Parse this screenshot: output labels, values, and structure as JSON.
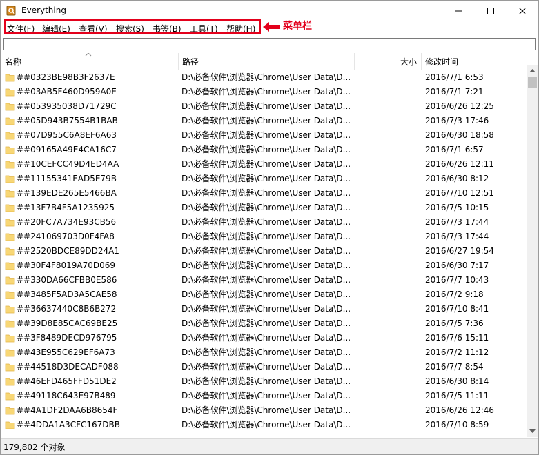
{
  "window": {
    "title": "Everything",
    "minimize_icon": "minimize-icon",
    "maximize_icon": "maximize-icon",
    "close_icon": "close-icon"
  },
  "menu": {
    "items": [
      {
        "label": "文件(F)"
      },
      {
        "label": "编辑(E)"
      },
      {
        "label": "查看(V)"
      },
      {
        "label": "搜索(S)"
      },
      {
        "label": "书签(B)"
      },
      {
        "label": "工具(T)"
      },
      {
        "label": "帮助(H)"
      }
    ]
  },
  "annotation": {
    "label": "菜单栏",
    "color": "#e3001b"
  },
  "search": {
    "value": "",
    "placeholder": ""
  },
  "table": {
    "columns": {
      "name": "名称",
      "path": "路径",
      "size": "大小",
      "modified": "修改时间"
    },
    "rows": [
      {
        "name": "##0323BE98B3F2637E",
        "path": "D:\\必备软件\\浏览器\\Chrome\\User Data\\D...",
        "size": "",
        "modified": "2016/7/1 6:53"
      },
      {
        "name": "##03AB5F460D959A0E",
        "path": "D:\\必备软件\\浏览器\\Chrome\\User Data\\D...",
        "size": "",
        "modified": "2016/7/1 7:21"
      },
      {
        "name": "##053935038D71729C",
        "path": "D:\\必备软件\\浏览器\\Chrome\\User Data\\D...",
        "size": "",
        "modified": "2016/6/26 12:25"
      },
      {
        "name": "##05D943B7554B1BAB",
        "path": "D:\\必备软件\\浏览器\\Chrome\\User Data\\D...",
        "size": "",
        "modified": "2016/7/3 17:46"
      },
      {
        "name": "##07D955C6A8EF6A63",
        "path": "D:\\必备软件\\浏览器\\Chrome\\User Data\\D...",
        "size": "",
        "modified": "2016/6/30 18:58"
      },
      {
        "name": "##09165A49E4CA16C7",
        "path": "D:\\必备软件\\浏览器\\Chrome\\User Data\\D...",
        "size": "",
        "modified": "2016/7/1 6:57"
      },
      {
        "name": "##10CEFCC49D4ED4AA",
        "path": "D:\\必备软件\\浏览器\\Chrome\\User Data\\D...",
        "size": "",
        "modified": "2016/6/26 12:11"
      },
      {
        "name": "##11155341EAD5E79B",
        "path": "D:\\必备软件\\浏览器\\Chrome\\User Data\\D...",
        "size": "",
        "modified": "2016/6/30 8:12"
      },
      {
        "name": "##139EDE265E5466BA",
        "path": "D:\\必备软件\\浏览器\\Chrome\\User Data\\D...",
        "size": "",
        "modified": "2016/7/10 12:51"
      },
      {
        "name": "##13F7B4F5A1235925",
        "path": "D:\\必备软件\\浏览器\\Chrome\\User Data\\D...",
        "size": "",
        "modified": "2016/7/5 10:15"
      },
      {
        "name": "##20FC7A734E93CB56",
        "path": "D:\\必备软件\\浏览器\\Chrome\\User Data\\D...",
        "size": "",
        "modified": "2016/7/3 17:44"
      },
      {
        "name": "##241069703D0F4FA8",
        "path": "D:\\必备软件\\浏览器\\Chrome\\User Data\\D...",
        "size": "",
        "modified": "2016/7/3 17:44"
      },
      {
        "name": "##2520BDCE89DD24A1",
        "path": "D:\\必备软件\\浏览器\\Chrome\\User Data\\D...",
        "size": "",
        "modified": "2016/6/27 19:54"
      },
      {
        "name": "##30F4F8019A70D069",
        "path": "D:\\必备软件\\浏览器\\Chrome\\User Data\\D...",
        "size": "",
        "modified": "2016/6/30 7:17"
      },
      {
        "name": "##330DA66CFBB0E586",
        "path": "D:\\必备软件\\浏览器\\Chrome\\User Data\\D...",
        "size": "",
        "modified": "2016/7/7 10:43"
      },
      {
        "name": "##3485F5AD3A5CAE58",
        "path": "D:\\必备软件\\浏览器\\Chrome\\User Data\\D...",
        "size": "",
        "modified": "2016/7/2 9:18"
      },
      {
        "name": "##36637440C8B6B272",
        "path": "D:\\必备软件\\浏览器\\Chrome\\User Data\\D...",
        "size": "",
        "modified": "2016/7/10 8:41"
      },
      {
        "name": "##39D8E85CAC69BE25",
        "path": "D:\\必备软件\\浏览器\\Chrome\\User Data\\D...",
        "size": "",
        "modified": "2016/7/5 7:36"
      },
      {
        "name": "##3F8489DECD976795",
        "path": "D:\\必备软件\\浏览器\\Chrome\\User Data\\D...",
        "size": "",
        "modified": "2016/7/6 15:11"
      },
      {
        "name": "##43E955C629EF6A73",
        "path": "D:\\必备软件\\浏览器\\Chrome\\User Data\\D...",
        "size": "",
        "modified": "2016/7/2 11:12"
      },
      {
        "name": "##44518D3DECADF088",
        "path": "D:\\必备软件\\浏览器\\Chrome\\User Data\\D...",
        "size": "",
        "modified": "2016/7/7 8:54"
      },
      {
        "name": "##46EFD465FFD51DE2",
        "path": "D:\\必备软件\\浏览器\\Chrome\\User Data\\D...",
        "size": "",
        "modified": "2016/6/30 8:14"
      },
      {
        "name": "##49118C643E97B489",
        "path": "D:\\必备软件\\浏览器\\Chrome\\User Data\\D...",
        "size": "",
        "modified": "2016/7/5 11:11"
      },
      {
        "name": "##4A1DF2DAA6B8654F",
        "path": "D:\\必备软件\\浏览器\\Chrome\\User Data\\D...",
        "size": "",
        "modified": "2016/6/26 12:46"
      },
      {
        "name": "##4DDA1A3CFC167DBB",
        "path": "D:\\必备软件\\浏览器\\Chrome\\User Data\\D...",
        "size": "",
        "modified": "2016/7/10 8:59"
      }
    ]
  },
  "status": {
    "text": "179,802 个对象"
  },
  "colors": {
    "folder_fill": "#f8d775",
    "folder_stroke": "#e2b445",
    "annotation_red": "#e3001b",
    "app_icon": "#d88a20"
  },
  "icons": {
    "folder": "folder-icon",
    "app": "everything-app-icon",
    "sort": "sort-ascending-icon",
    "scroll_up": "scroll-up-icon",
    "scroll_down": "scroll-down-icon",
    "annotation_arrow": "arrow-left-icon"
  }
}
